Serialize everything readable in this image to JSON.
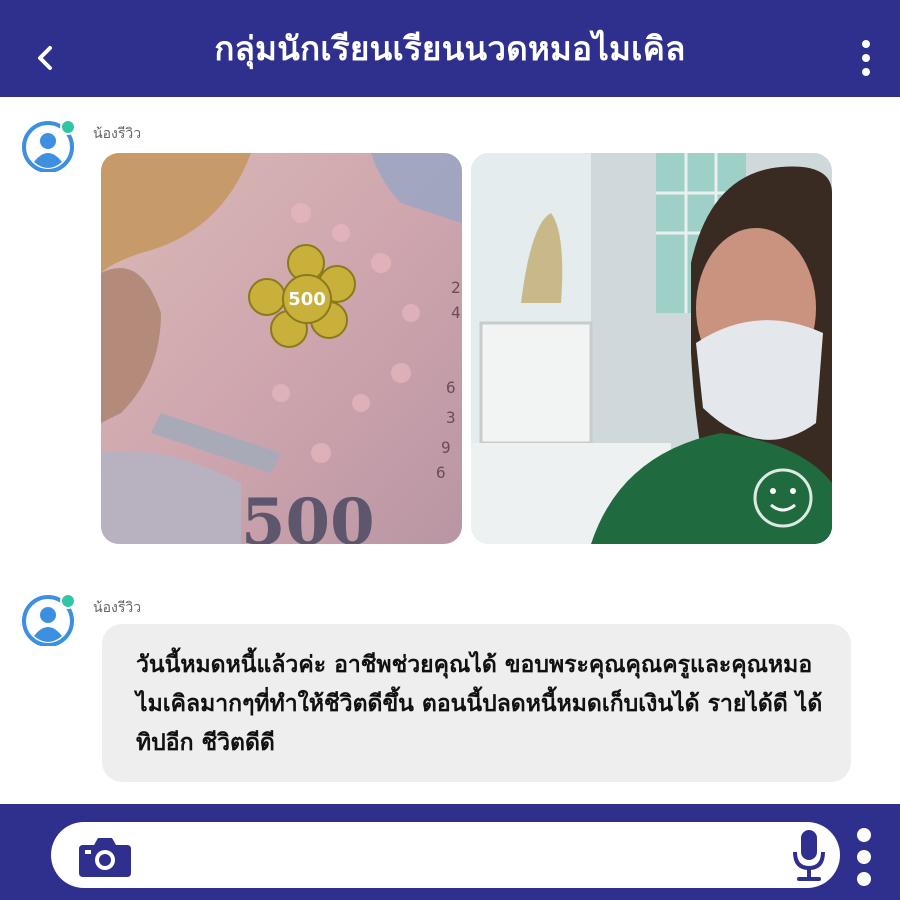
{
  "header": {
    "title": "กลุ่มนักเรียนเรียนนวดหมอไมเคิล",
    "back_icon": "chevron-left-icon",
    "menu_icon": "more-vertical-icon"
  },
  "colors": {
    "brand": "#2f2f8e",
    "avatar_blue": "#3d8fe0",
    "online": "#2fc6a6",
    "bubble": "#eeeeee"
  },
  "messages": [
    {
      "sender": "น้องรีวิว",
      "type": "images",
      "images": [
        "banknote-500-photo",
        "woman-mask-selfie-photo"
      ],
      "note_on_banknote": "500"
    },
    {
      "sender": "น้องรีวิว",
      "type": "text",
      "text": "วันนี้หมดหนี้แล้วค่ะ อาชีพช่วยคุณได้ ขอบพระคุณคุณครูและคุณหมอไมเคิลมากๆที่ทำให้ชีวิตดีขึ้น ตอนนี้ปลดหนี้หมดเก็บเงินได้ รายได้ดี ได้ทิปอีก ชีวิตดีดี"
    }
  ],
  "input_bar": {
    "placeholder": "",
    "camera_icon": "camera-icon",
    "mic_icon": "microphone-icon",
    "menu_icon": "more-vertical-icon"
  }
}
